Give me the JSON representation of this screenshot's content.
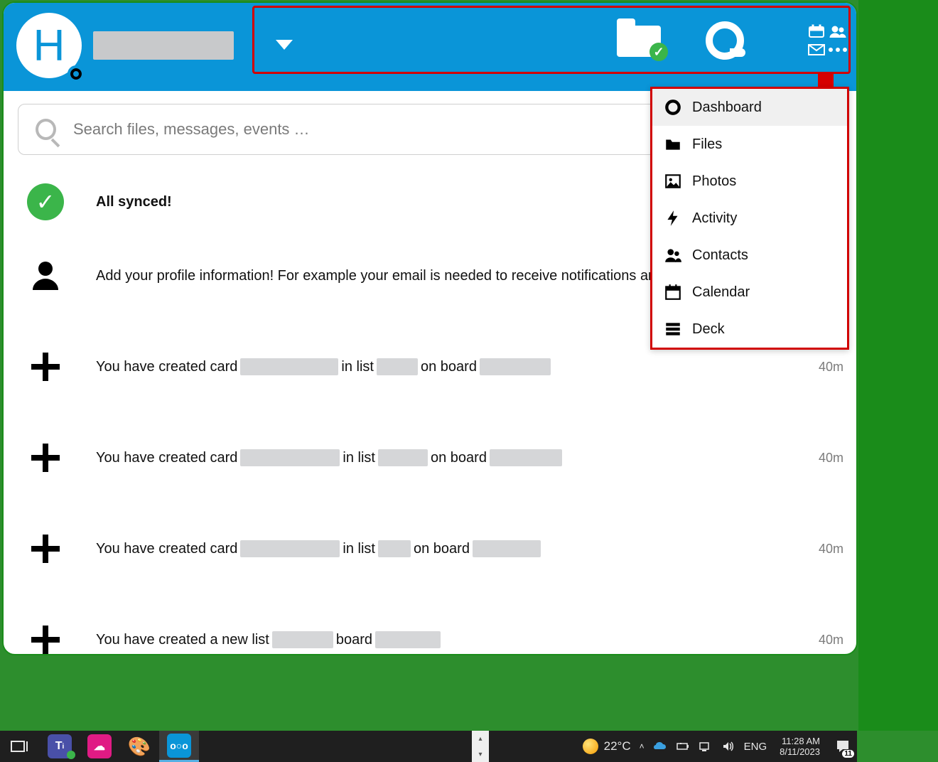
{
  "header": {
    "avatar_letter": "H",
    "dropdown_highlighted": true
  },
  "apps_menu": [
    {
      "id": "dashboard",
      "label": "Dashboard",
      "active": true
    },
    {
      "id": "files",
      "label": "Files"
    },
    {
      "id": "photos",
      "label": "Photos"
    },
    {
      "id": "activity",
      "label": "Activity"
    },
    {
      "id": "contacts",
      "label": "Contacts"
    },
    {
      "id": "calendar",
      "label": "Calendar"
    },
    {
      "id": "deck",
      "label": "Deck"
    }
  ],
  "search": {
    "placeholder": "Search files, messages, events …"
  },
  "feed": {
    "synced_label": "All synced!",
    "profile_prompt": "Add your profile information! For example your email is needed to receive notifications and reset your password.",
    "created_card_prefix": "You have created card",
    "in_list": "in list",
    "on_board": "on board",
    "new_list_prefix": "You have created a new list",
    "board_word": "board",
    "items": [
      {
        "type": "card",
        "ts": "40m",
        "chips": [
          138,
          58,
          100
        ]
      },
      {
        "type": "card",
        "ts": "40m",
        "chips": [
          140,
          70,
          102
        ]
      },
      {
        "type": "card",
        "ts": "40m",
        "chips": [
          140,
          46,
          96
        ]
      },
      {
        "type": "list",
        "ts": "40m",
        "chips": [
          86,
          92
        ]
      }
    ]
  },
  "taskbar": {
    "weather": "22°C",
    "lang": "ENG",
    "time": "11:28 AM",
    "date": "8/11/2023",
    "notif_count": "11"
  }
}
